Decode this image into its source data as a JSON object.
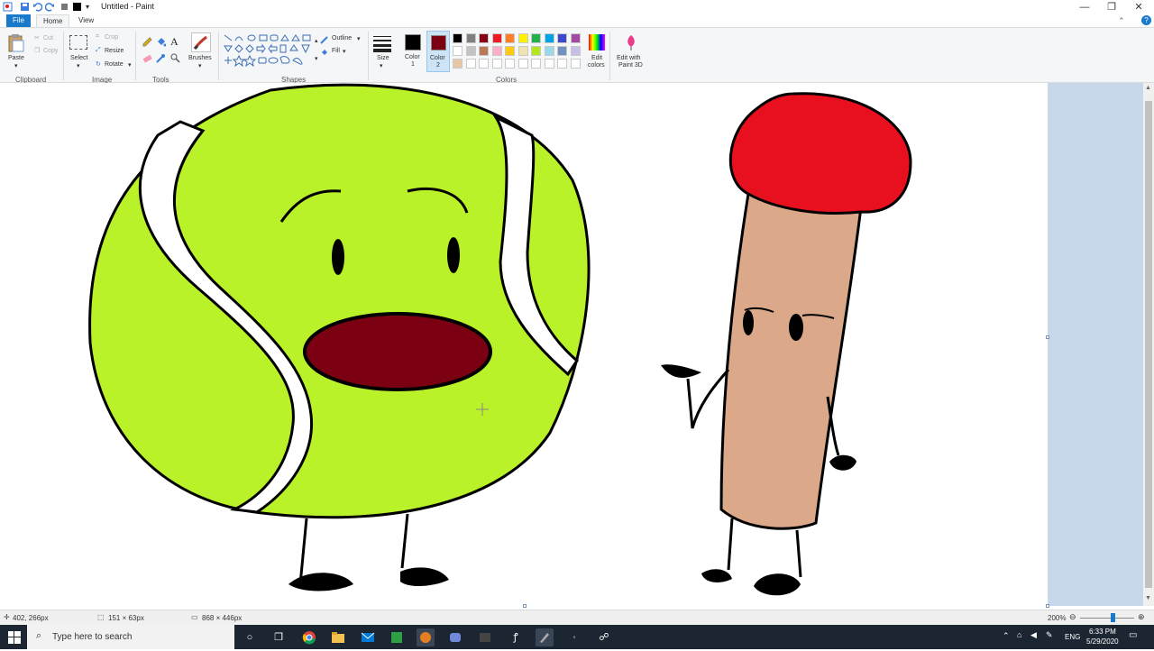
{
  "window": {
    "title": "Untitled - Paint",
    "minimize": "—",
    "maximize": "❐",
    "close": "✕"
  },
  "tabs": {
    "file": "File",
    "home": "Home",
    "view": "View"
  },
  "ribbon": {
    "clipboard": {
      "paste": "Paste",
      "cut": "Cut",
      "copy": "Copy",
      "label": "Clipboard"
    },
    "image": {
      "select": "Select",
      "crop": "Crop",
      "resize": "Resize",
      "rotate": "Rotate",
      "label": "Image"
    },
    "tools": {
      "text_glyph": "A",
      "label": "Tools"
    },
    "brushes": {
      "label": "Brushes"
    },
    "shapes": {
      "outline": "Outline",
      "fill": "Fill",
      "label": "Shapes"
    },
    "size": {
      "label": "Size"
    },
    "color1": {
      "label_line1": "Color",
      "label_line2": "1",
      "value": "#000000"
    },
    "color2": {
      "label_line1": "Color",
      "label_line2": "2",
      "value": "#7a0012"
    },
    "colors": {
      "label": "Colors",
      "row1": [
        "#000000",
        "#7f7f7f",
        "#880015",
        "#ed1c24",
        "#ff7f27",
        "#fff200",
        "#22b14c",
        "#00a2e8",
        "#3f48cc",
        "#a349a4"
      ],
      "row2": [
        "#ffffff",
        "#c3c3c3",
        "#b97a57",
        "#ffaec9",
        "#ffc90e",
        "#efe4b0",
        "#b5e61d",
        "#99d9ea",
        "#7092be",
        "#c8bfe7"
      ],
      "row3": [
        "#e8c7a8",
        "#ffffff",
        "#ffffff",
        "#ffffff",
        "#ffffff",
        "#ffffff",
        "#ffffff",
        "#ffffff",
        "#ffffff",
        "#ffffff"
      ]
    },
    "edit_colors": {
      "line1": "Edit",
      "line2": "colors"
    },
    "paint3d": {
      "line1": "Edit with",
      "line2": "Paint 3D"
    }
  },
  "drawing": {
    "tennis_ball_color": "#b9f229",
    "mouth_color": "#7a0012",
    "match_head_color": "#e8101e",
    "match_stick_color": "#dba98a"
  },
  "status": {
    "cursor_pos": "402, 266px",
    "selection_size": "151 × 63px",
    "canvas_size": "868 × 446px",
    "zoom": "200%"
  },
  "taskbar": {
    "search_placeholder": "Type here to search",
    "language": "ENG",
    "time": "6:33 PM",
    "date": "5/29/2020"
  }
}
